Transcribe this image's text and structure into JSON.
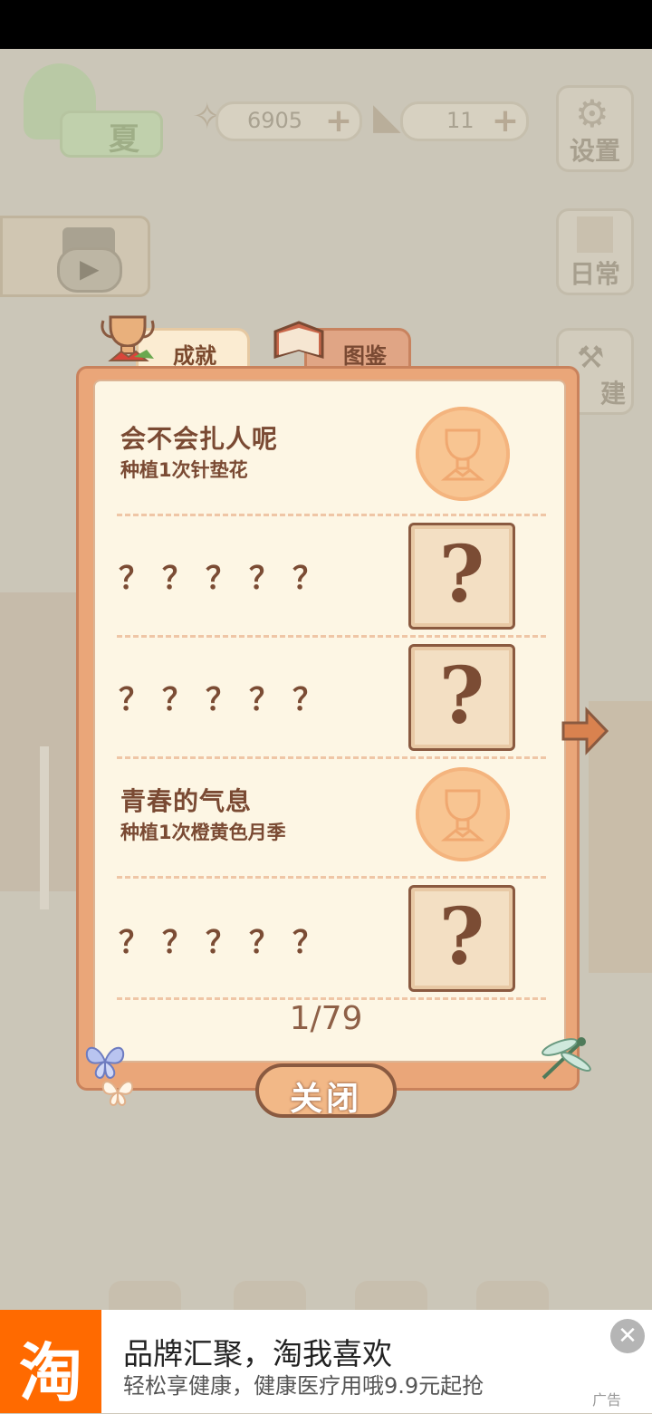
{
  "hud": {
    "season_label": "夏",
    "fish_value": "6905",
    "cheese_value": "11",
    "plus_symbol": "+"
  },
  "side_menu": {
    "settings_label": "设置",
    "daily_label": "日常",
    "build_label": "建"
  },
  "tabs": {
    "achievements": "成就",
    "collection": "图鉴"
  },
  "achievements": [
    {
      "type": "unlocked",
      "title": "会不会扎人呢",
      "desc": "种植1次针垫花"
    },
    {
      "type": "locked",
      "title": "？？？？？"
    },
    {
      "type": "locked",
      "title": "？？？？？"
    },
    {
      "type": "unlocked",
      "title": "青春的气息",
      "desc": "种植1次橙黄色月季"
    },
    {
      "type": "locked",
      "title": "？？？？？"
    }
  ],
  "locked_symbol": "?",
  "pager": "1/79",
  "close_label": "关闭",
  "ad": {
    "logo_text": "淘",
    "title": "品牌汇聚，淘我喜欢",
    "subtitle": "轻松享健康，健康医疗用哦9.9元起抢",
    "tag": "广告",
    "close_symbol": "✕"
  },
  "colors": {
    "dialog_frame": "#eaa679",
    "dialog_paper": "#fdf6e4",
    "text_brown": "#7a4a33",
    "ad_brand": "#ff6a00"
  }
}
